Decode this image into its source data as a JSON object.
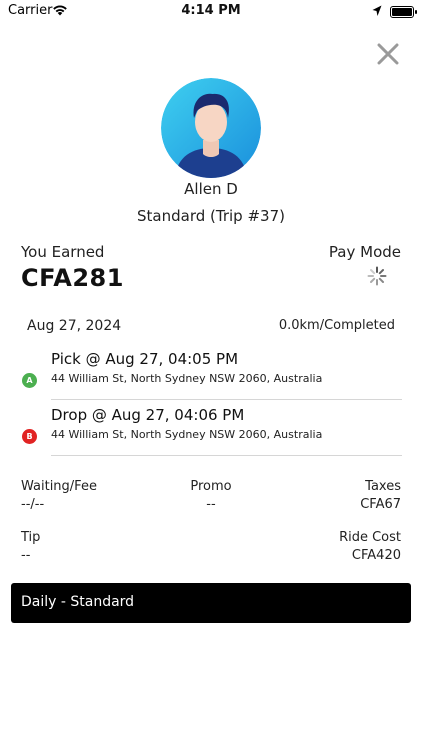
{
  "status_bar": {
    "carrier": "Carrier",
    "time": "4:14 PM"
  },
  "profile": {
    "name": "Allen D",
    "subtitle": "Standard (Trip #37)"
  },
  "earnings": {
    "label": "You Earned",
    "amount": "CFA281",
    "pay_mode_label": "Pay Mode"
  },
  "trip": {
    "date": "Aug 27, 2024",
    "distance_status": "0.0km/Completed",
    "pickup": {
      "marker": "A",
      "title": "Pick @ Aug 27, 04:05 PM",
      "address": "44 William St, North Sydney NSW 2060, Australia"
    },
    "dropoff": {
      "marker": "B",
      "title": "Drop @ Aug 27, 04:06 PM",
      "address": "44 William St, North Sydney NSW 2060, Australia"
    }
  },
  "fees": {
    "waiting": {
      "label": "Waiting/Fee",
      "value": "--/--"
    },
    "promo": {
      "label": "Promo",
      "value": "--"
    },
    "taxes": {
      "label": "Taxes",
      "value": "CFA67"
    },
    "tip": {
      "label": "Tip",
      "value": "--"
    },
    "ride_cost": {
      "label": "Ride Cost",
      "value": "CFA420"
    }
  },
  "plan": {
    "label": "Daily - Standard"
  },
  "colors": {
    "marker_a": "#4caf50",
    "marker_b": "#e12323",
    "plan_bar": "#000000",
    "avatar_bg": "#2ab6e8"
  },
  "icons": {
    "close": "close-icon",
    "wifi": "wifi-icon",
    "location": "location-arrow-icon",
    "battery": "battery-icon",
    "loading": "loading-spinner-icon"
  }
}
